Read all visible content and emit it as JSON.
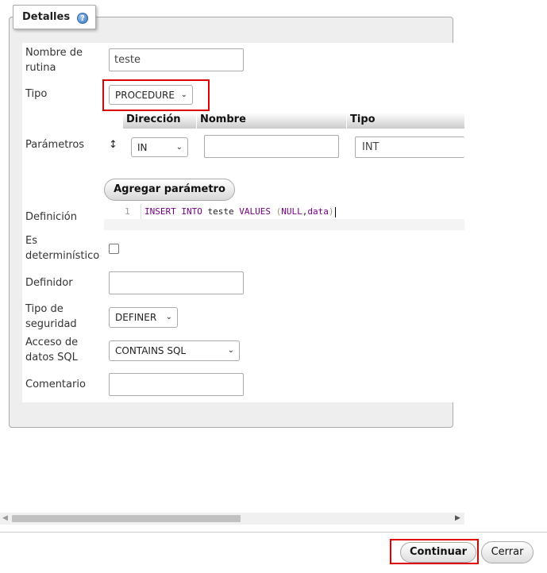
{
  "legend": {
    "title": "Detalles",
    "help_icon": "help-icon"
  },
  "fields": {
    "routine_name": {
      "label": "Nombre de rutina",
      "value": "teste"
    },
    "type": {
      "label": "Tipo",
      "value": "PROCEDURE"
    },
    "parameters": {
      "label": "Parámetros",
      "columns": [
        "Dirección",
        "Nombre",
        "Tipo"
      ],
      "rows": [
        {
          "direction": "IN",
          "name": "",
          "type": "INT"
        }
      ],
      "drag_icon": "updown-arrows-icon",
      "add_button": "Agregar parámetro"
    },
    "definition": {
      "label": "Definición",
      "line_number": "1",
      "code": "INSERT INTO teste VALUES (NULL,data)"
    },
    "deterministic": {
      "label": "Es determinístico",
      "checked": false
    },
    "definer": {
      "label": "Definidor",
      "value": ""
    },
    "security_type": {
      "label": "Tipo de seguridad",
      "value": "DEFINER"
    },
    "sql_data_access": {
      "label": "Acceso de datos SQL",
      "value": "CONTAINS SQL"
    },
    "comment": {
      "label": "Comentario",
      "value": ""
    }
  },
  "footer": {
    "continue": "Continuar",
    "close": "Cerrar"
  },
  "colors": {
    "highlight": "#e00000",
    "panel": "#eeeeee"
  }
}
